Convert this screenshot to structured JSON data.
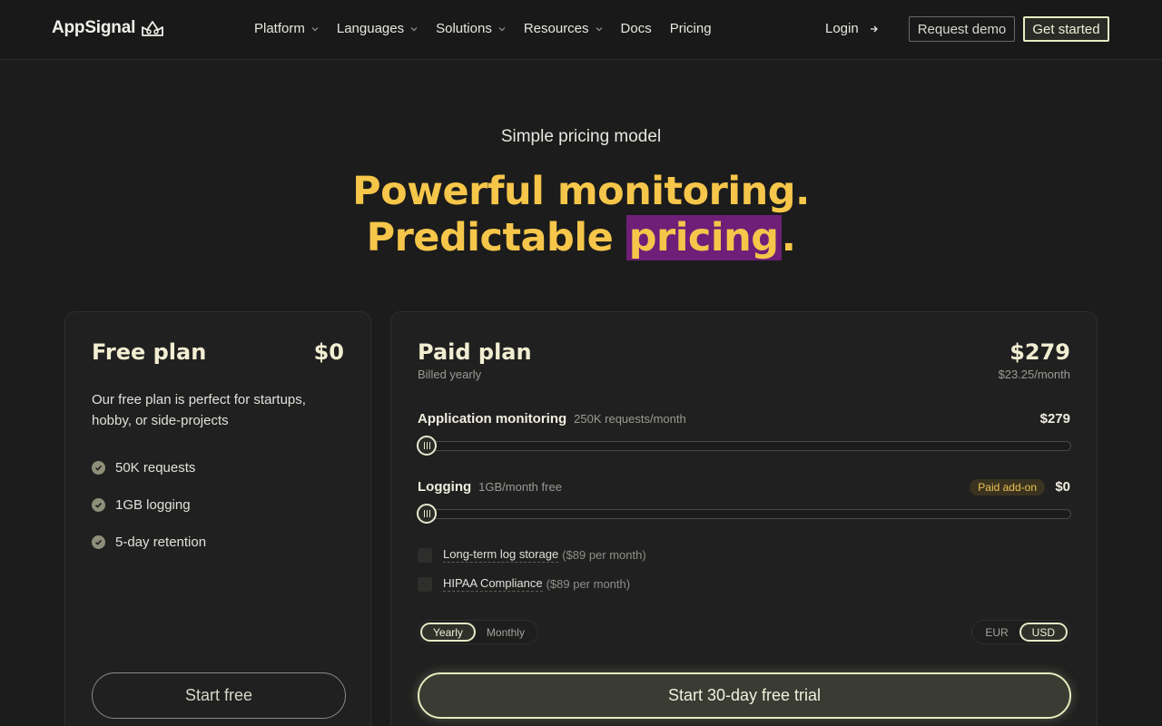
{
  "nav": {
    "logo": "AppSignal",
    "items": [
      {
        "label": "Platform",
        "dropdown": true
      },
      {
        "label": "Languages",
        "dropdown": true
      },
      {
        "label": "Solutions",
        "dropdown": true
      },
      {
        "label": "Resources",
        "dropdown": true
      },
      {
        "label": "Docs",
        "dropdown": false
      },
      {
        "label": "Pricing",
        "dropdown": false
      }
    ],
    "login": "Login",
    "request_demo": "Request demo",
    "get_started": "Get started"
  },
  "hero": {
    "eyebrow": "Simple pricing model",
    "line1": "Powerful monitoring.",
    "line2_pre": "Predictable ",
    "line2_highlight": "pricing",
    "line2_post": "."
  },
  "free_plan": {
    "title": "Free plan",
    "price": "$0",
    "description": "Our free plan is perfect for startups, hobby, or side-projects",
    "features": [
      "50K requests",
      "1GB logging",
      "5-day retention"
    ],
    "cta": "Start free"
  },
  "paid_plan": {
    "title": "Paid plan",
    "price": "$279",
    "billing": "Billed yearly",
    "per_month": "$23.25/month",
    "app_monitoring": {
      "label": "Application monitoring",
      "detail": "250K requests/month",
      "price": "$279",
      "slider_level": 0
    },
    "logging": {
      "label": "Logging",
      "detail": "1GB/month free",
      "badge": "Paid add-on",
      "price": "$0",
      "slider_level": 0
    },
    "addons": [
      {
        "label": "Long-term log storage",
        "price": "($89 per month)",
        "checked": false
      },
      {
        "label": "HIPAA Compliance",
        "price": "($89 per month)",
        "checked": false
      }
    ],
    "billing_toggle": {
      "options": [
        "Yearly",
        "Monthly"
      ],
      "selected": "Yearly"
    },
    "currency_toggle": {
      "options": [
        "EUR",
        "USD"
      ],
      "selected": "USD"
    },
    "cta": "Start 30-day free trial"
  },
  "colors": {
    "accent": "#f6c64a",
    "highlight": "#6e1f78",
    "background": "#1c1c1c",
    "card": "#202020"
  }
}
